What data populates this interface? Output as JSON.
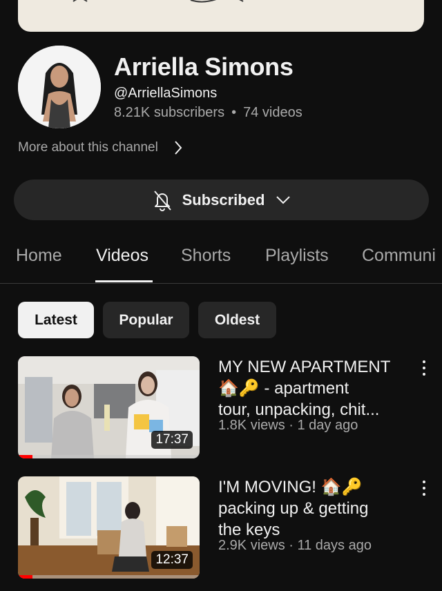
{
  "channel": {
    "name": "Arriella Simons",
    "handle": "@ArriellaSimons",
    "subscribers": "8.21K subscribers",
    "separator": "•",
    "videos_count": "74 videos",
    "more_label": "More about this channel"
  },
  "subscribe": {
    "label": "Subscribed",
    "bell_icon": "bell-off-icon",
    "chevron_icon": "chevron-down-icon"
  },
  "tabs": [
    {
      "label": "Home",
      "active": false
    },
    {
      "label": "Videos",
      "active": true
    },
    {
      "label": "Shorts",
      "active": false
    },
    {
      "label": "Playlists",
      "active": false
    },
    {
      "label": "Communi",
      "active": false
    }
  ],
  "filters": [
    {
      "label": "Latest",
      "active": true
    },
    {
      "label": "Popular",
      "active": false
    },
    {
      "label": "Oldest",
      "active": false
    }
  ],
  "videos": [
    {
      "title_lines": [
        "MY NEW APARTMENT",
        "🏠🔑 - apartment",
        "tour, unpacking, chit..."
      ],
      "meta": "1.8K views · 1 day ago",
      "duration": "17:37",
      "watched_fraction": 0.08
    },
    {
      "title_lines": [
        "I'M MOVING! 🏠🔑",
        "packing up & getting",
        "the keys"
      ],
      "meta": "2.9K views · 11 days ago",
      "duration": "12:37",
      "watched_fraction": 0.08
    }
  ],
  "colors": {
    "background": "#0f0f0f",
    "surface": "#272727",
    "text_primary": "#f1f1f1",
    "text_secondary": "#aaaaaa",
    "progress": "#ff0000"
  }
}
